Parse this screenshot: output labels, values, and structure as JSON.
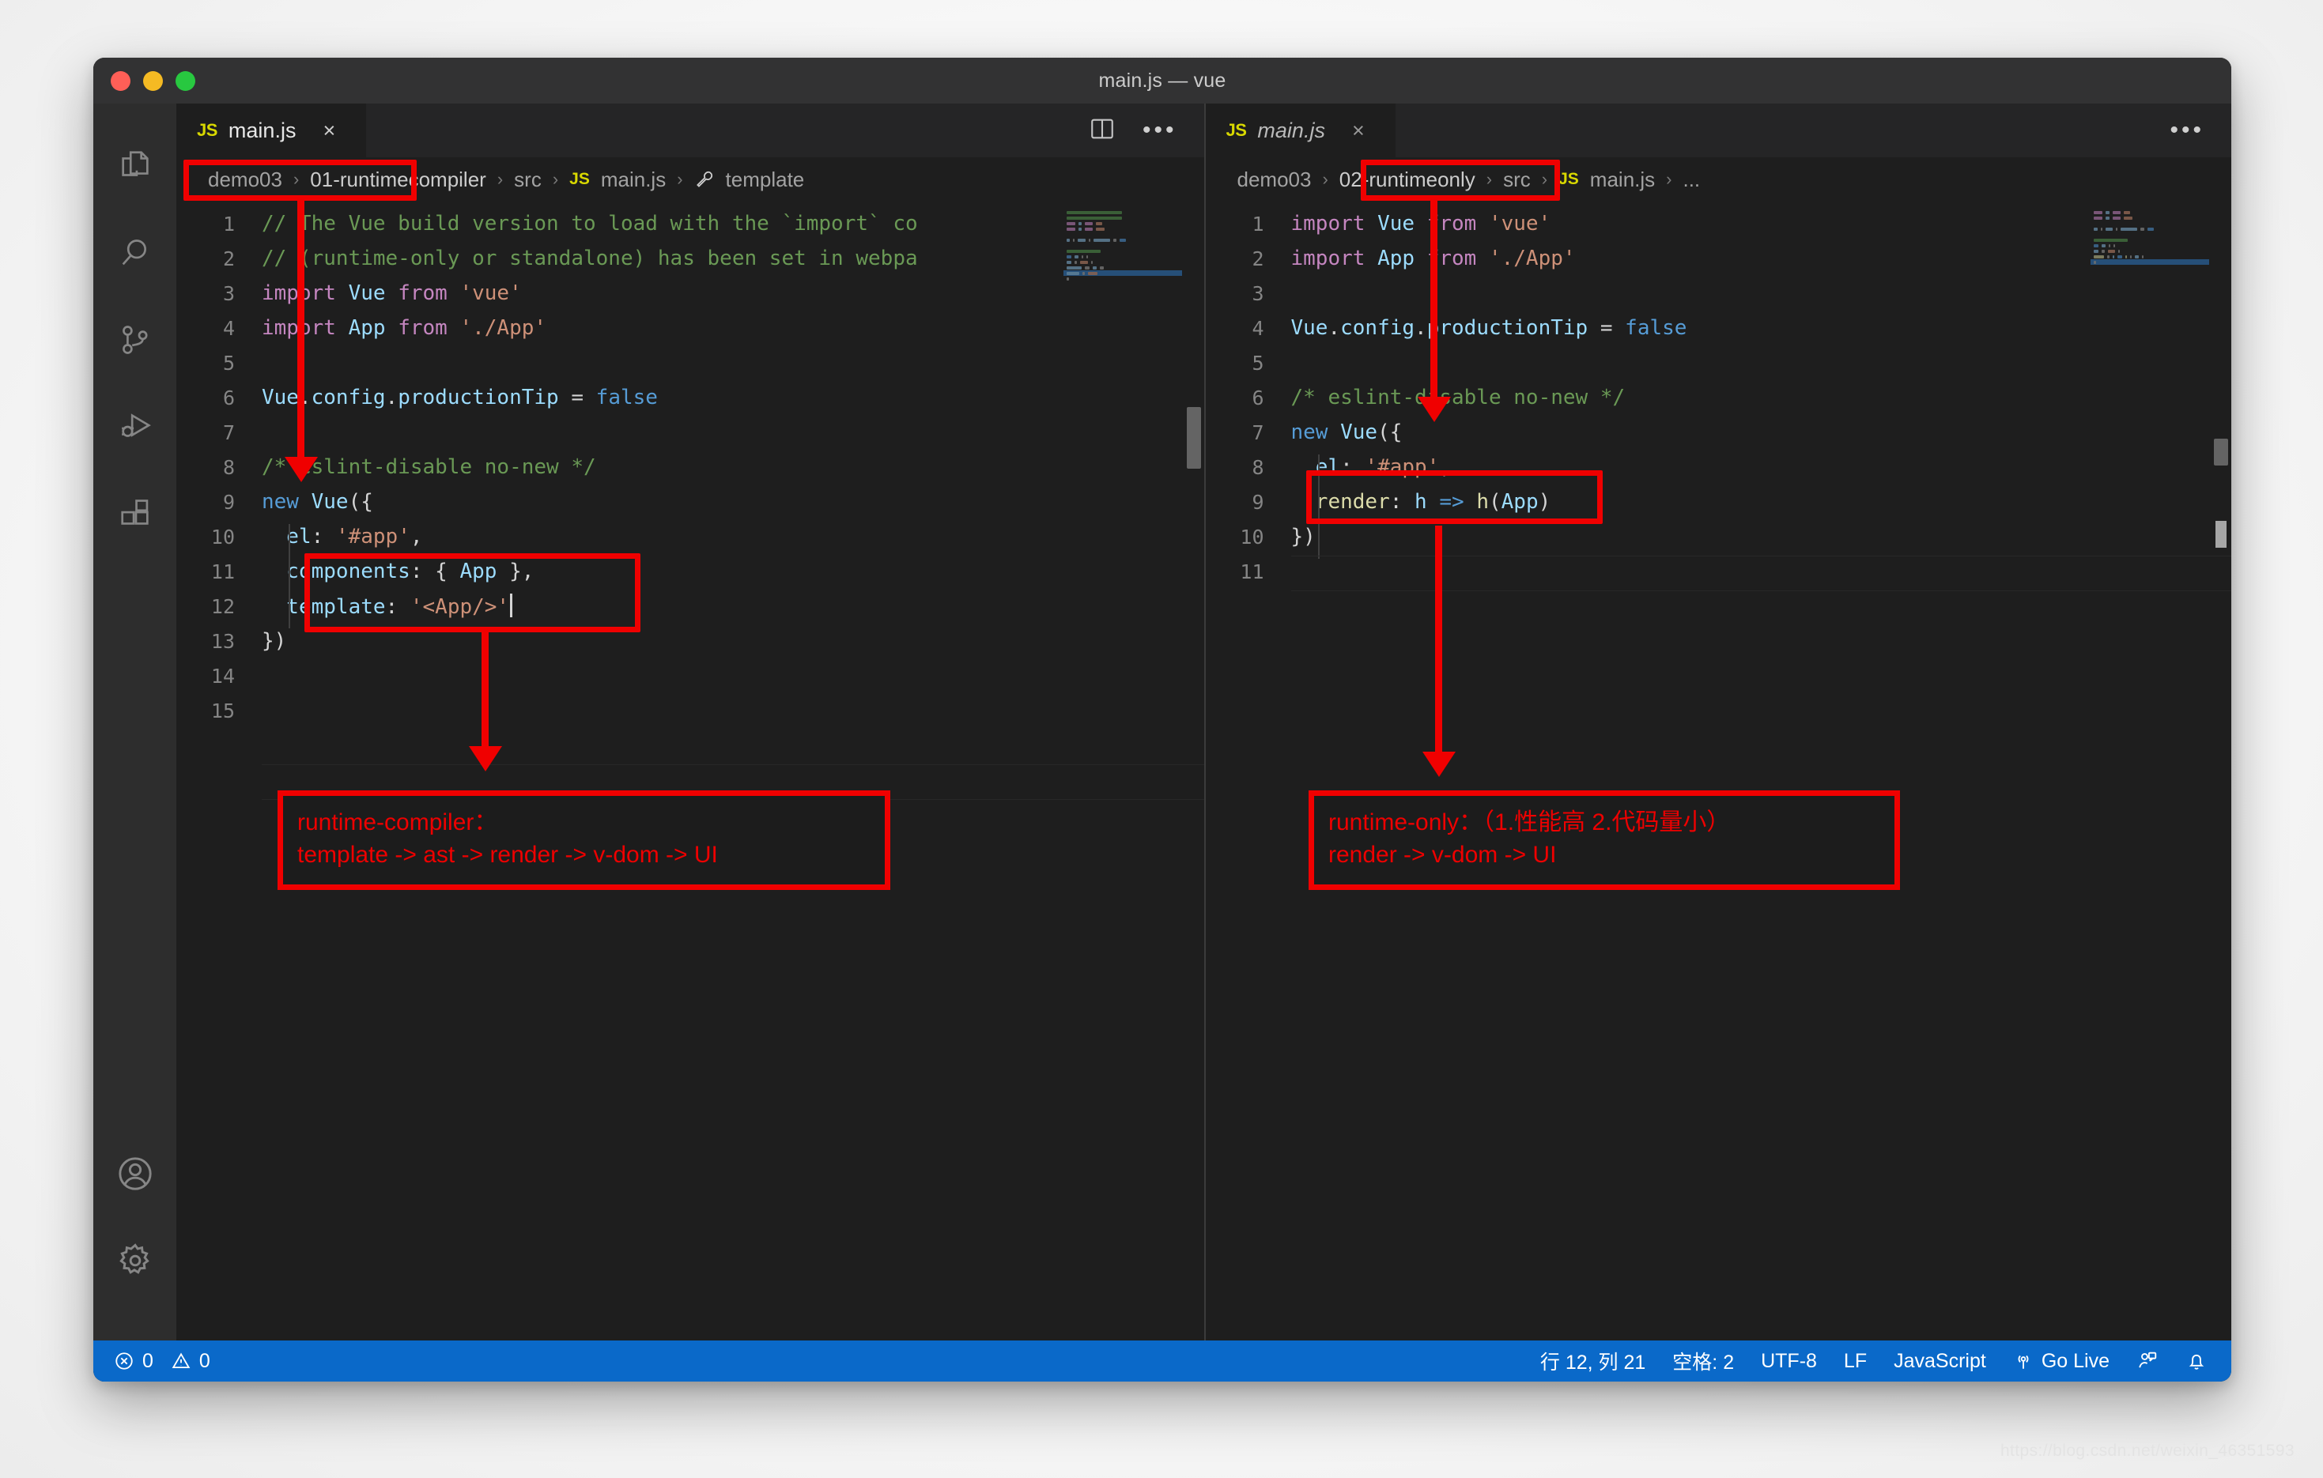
{
  "window": {
    "title": "main.js — vue",
    "traffic_lights": [
      "close-red",
      "minimize-yellow",
      "maximize-green"
    ]
  },
  "activity_bar": {
    "top_items": [
      {
        "name": "explorer",
        "icon": "files-icon"
      },
      {
        "name": "search",
        "icon": "search-icon"
      },
      {
        "name": "source-control",
        "icon": "source-control-icon"
      },
      {
        "name": "run-debug",
        "icon": "run-debug-icon"
      },
      {
        "name": "extensions",
        "icon": "extensions-icon"
      }
    ],
    "bottom_items": [
      {
        "name": "accounts",
        "icon": "account-icon"
      },
      {
        "name": "manage",
        "icon": "gear-icon"
      }
    ]
  },
  "left_editor": {
    "tab": {
      "label": "main.js",
      "badge": "JS",
      "close": "×",
      "preview": false
    },
    "actions": {
      "split": "split-editor-icon",
      "more": "•••"
    },
    "breadcrumbs": [
      {
        "label": "demo03",
        "highlight": false
      },
      {
        "label": "01-runtimecompiler",
        "highlight": true
      },
      {
        "label": "src",
        "highlight": false
      },
      {
        "label": "main.js",
        "highlight": false,
        "badge": "JS"
      },
      {
        "label": "template",
        "highlight": false,
        "icon": "wrench-icon"
      }
    ],
    "lines": [
      {
        "n": 1,
        "tokens": [
          {
            "t": "// The Vue build version to load with the `import` co",
            "c": "t-com"
          }
        ]
      },
      {
        "n": 2,
        "tokens": [
          {
            "t": "// (runtime-only or standalone) has been set in webpa",
            "c": "t-com"
          }
        ]
      },
      {
        "n": 3,
        "tokens": [
          {
            "t": "import ",
            "c": "t-kw"
          },
          {
            "t": "Vue",
            "c": "t-var"
          },
          {
            "t": " from ",
            "c": "t-kw"
          },
          {
            "t": "'vue'",
            "c": "t-str"
          }
        ]
      },
      {
        "n": 4,
        "tokens": [
          {
            "t": "import ",
            "c": "t-kw"
          },
          {
            "t": "App",
            "c": "t-var"
          },
          {
            "t": " from ",
            "c": "t-kw"
          },
          {
            "t": "'./App'",
            "c": "t-str"
          }
        ]
      },
      {
        "n": 5,
        "tokens": []
      },
      {
        "n": 6,
        "tokens": [
          {
            "t": "Vue",
            "c": "t-var"
          },
          {
            "t": ".",
            "c": "t-pun"
          },
          {
            "t": "config",
            "c": "t-var"
          },
          {
            "t": ".",
            "c": "t-pun"
          },
          {
            "t": "productionTip",
            "c": "t-var"
          },
          {
            "t": " = ",
            "c": "t-pun"
          },
          {
            "t": "false",
            "c": "t-blue"
          }
        ]
      },
      {
        "n": 7,
        "tokens": []
      },
      {
        "n": 8,
        "tokens": [
          {
            "t": "/* eslint-disable no-new */",
            "c": "t-com"
          }
        ]
      },
      {
        "n": 9,
        "tokens": [
          {
            "t": "new ",
            "c": "t-blue"
          },
          {
            "t": "Vue",
            "c": "t-var"
          },
          {
            "t": "(",
            "c": "t-pun"
          },
          {
            "t": "{",
            "c": "t-pun"
          }
        ]
      },
      {
        "n": 10,
        "tokens": [
          {
            "t": "  el",
            "c": "t-var"
          },
          {
            "t": ": ",
            "c": "t-pun"
          },
          {
            "t": "'#app'",
            "c": "t-str"
          },
          {
            "t": ",",
            "c": "t-pun"
          }
        ]
      },
      {
        "n": 11,
        "tokens": [
          {
            "t": "  components",
            "c": "t-var"
          },
          {
            "t": ": { ",
            "c": "t-pun"
          },
          {
            "t": "App",
            "c": "t-var"
          },
          {
            "t": " },",
            "c": "t-pun"
          }
        ]
      },
      {
        "n": 12,
        "tokens": [
          {
            "t": "  template",
            "c": "t-var"
          },
          {
            "t": ": ",
            "c": "t-pun"
          },
          {
            "t": "'<App/>'",
            "c": "t-str"
          }
        ],
        "cursor": true
      },
      {
        "n": 13,
        "tokens": [
          {
            "t": "})",
            "c": "t-pun"
          }
        ]
      },
      {
        "n": 14,
        "tokens": []
      },
      {
        "n": 15,
        "tokens": []
      }
    ],
    "annotation_note": "runtime-compiler：\ntemplate -> ast -> render -> v-dom -> UI"
  },
  "right_editor": {
    "tab": {
      "label": "main.js",
      "badge": "JS",
      "close": "×",
      "preview": true
    },
    "actions": {
      "more": "•••"
    },
    "breadcrumbs": [
      {
        "label": "demo03",
        "highlight": false
      },
      {
        "label": "02-runtimeonly",
        "highlight": true
      },
      {
        "label": "src",
        "highlight": false
      },
      {
        "label": "main.js",
        "highlight": false,
        "badge": "JS"
      },
      {
        "label": "...",
        "highlight": false
      }
    ],
    "lines": [
      {
        "n": 1,
        "tokens": [
          {
            "t": "import ",
            "c": "t-kw"
          },
          {
            "t": "Vue",
            "c": "t-var"
          },
          {
            "t": " from ",
            "c": "t-kw"
          },
          {
            "t": "'vue'",
            "c": "t-str"
          }
        ]
      },
      {
        "n": 2,
        "tokens": [
          {
            "t": "import ",
            "c": "t-kw"
          },
          {
            "t": "App",
            "c": "t-var"
          },
          {
            "t": " from ",
            "c": "t-kw"
          },
          {
            "t": "'./App'",
            "c": "t-str"
          }
        ]
      },
      {
        "n": 3,
        "tokens": []
      },
      {
        "n": 4,
        "tokens": [
          {
            "t": "Vue",
            "c": "t-var"
          },
          {
            "t": ".",
            "c": "t-pun"
          },
          {
            "t": "config",
            "c": "t-var"
          },
          {
            "t": ".",
            "c": "t-pun"
          },
          {
            "t": "productionTip",
            "c": "t-var"
          },
          {
            "t": " = ",
            "c": "t-pun"
          },
          {
            "t": "false",
            "c": "t-blue"
          }
        ]
      },
      {
        "n": 5,
        "tokens": []
      },
      {
        "n": 6,
        "tokens": [
          {
            "t": "/* eslint-disable no-new */",
            "c": "t-com"
          }
        ]
      },
      {
        "n": 7,
        "tokens": [
          {
            "t": "new ",
            "c": "t-blue"
          },
          {
            "t": "Vue",
            "c": "t-var"
          },
          {
            "t": "(",
            "c": "t-pun"
          },
          {
            "t": "{",
            "c": "t-pun"
          }
        ]
      },
      {
        "n": 8,
        "tokens": [
          {
            "t": "  el",
            "c": "t-var"
          },
          {
            "t": ": ",
            "c": "t-pun"
          },
          {
            "t": "'#app'",
            "c": "t-str"
          },
          {
            "t": ",",
            "c": "t-pun"
          }
        ]
      },
      {
        "n": 9,
        "tokens": [
          {
            "t": "  render",
            "c": "t-fn"
          },
          {
            "t": ": ",
            "c": "t-pun"
          },
          {
            "t": "h",
            "c": "t-var"
          },
          {
            "t": " => ",
            "c": "t-blue"
          },
          {
            "t": "h",
            "c": "t-fn"
          },
          {
            "t": "(",
            "c": "t-pun"
          },
          {
            "t": "App",
            "c": "t-var"
          },
          {
            "t": ")",
            "c": "t-pun"
          }
        ]
      },
      {
        "n": 10,
        "tokens": [
          {
            "t": "})",
            "c": "t-pun"
          }
        ]
      },
      {
        "n": 11,
        "tokens": []
      }
    ],
    "annotation_note": "runtime-only：（1.性能高 2.代码量小）\nrender -> v-dom -> UI"
  },
  "status_bar": {
    "errors": "0",
    "warnings": "0",
    "cursor_position": "行 12, 列 21",
    "indentation": "空格: 2",
    "encoding": "UTF-8",
    "eol": "LF",
    "language": "JavaScript",
    "go_live": "Go Live",
    "feedback_icon": "feedback-icon",
    "bell_icon": "bell-icon",
    "background_color": "#0a69c9"
  },
  "watermark": "https://blog.csdn.net/weixin_46351593",
  "accent_colors": {
    "annotation_red": "#f00000",
    "status_blue": "#0a69c9",
    "js_yellow": "#d8d800"
  }
}
